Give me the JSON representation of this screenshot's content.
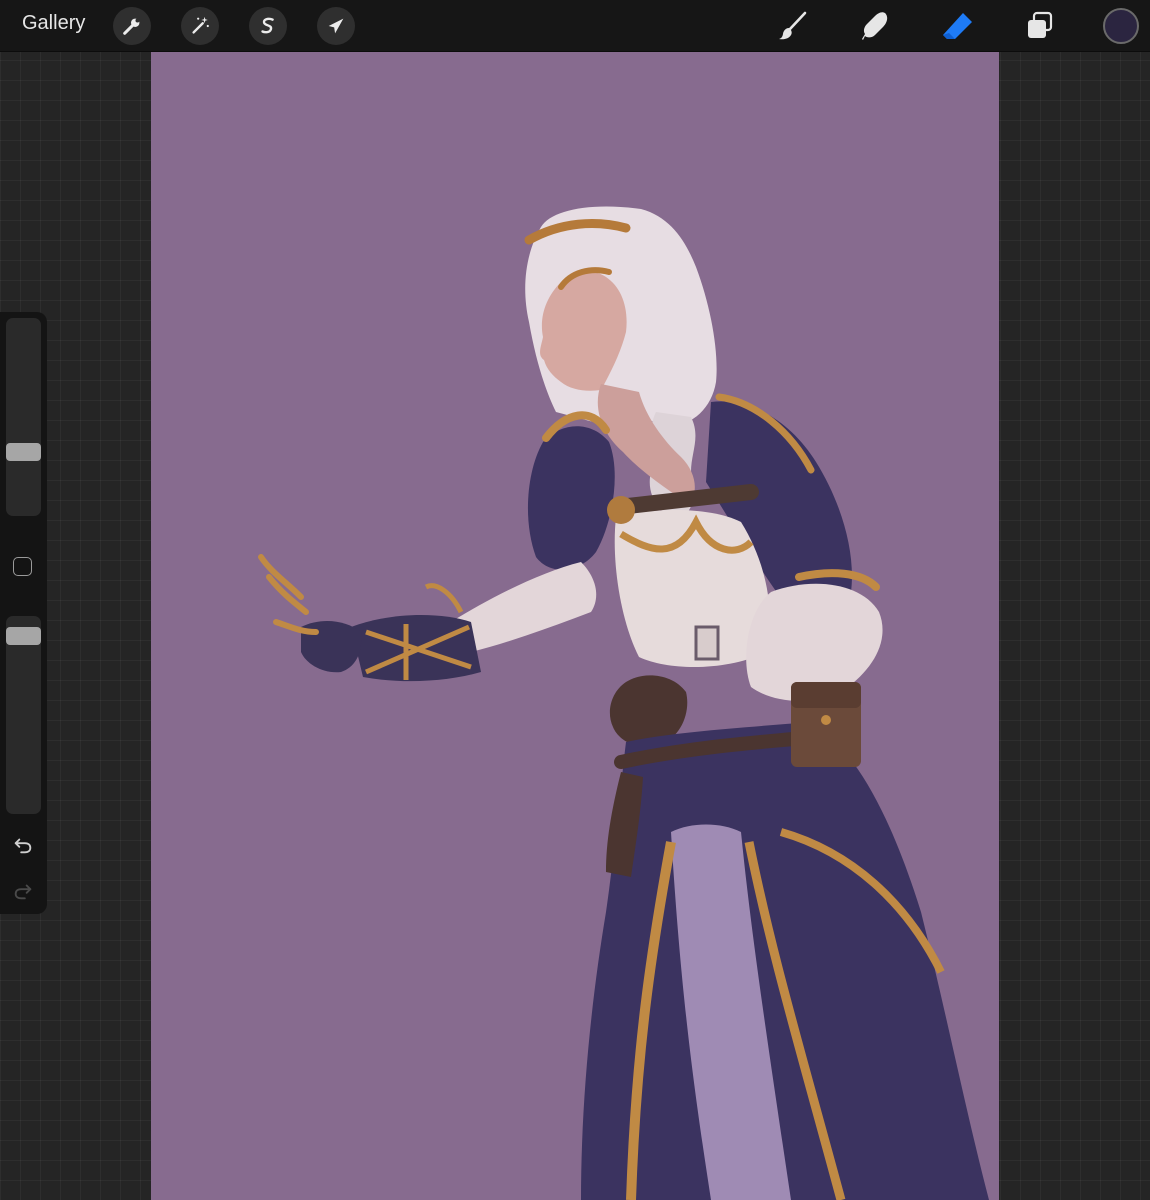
{
  "toolbar": {
    "gallery_label": "Gallery",
    "left_tools": [
      {
        "name": "actions",
        "icon": "wrench-icon"
      },
      {
        "name": "adjustments",
        "icon": "magic-wand-icon"
      },
      {
        "name": "selection",
        "icon": "selection-s-icon"
      },
      {
        "name": "transform",
        "icon": "arrow-cursor-icon"
      }
    ],
    "right_tools": [
      {
        "name": "brush",
        "icon": "brush-icon",
        "active": false
      },
      {
        "name": "smudge",
        "icon": "smudge-finger-icon",
        "active": false
      },
      {
        "name": "eraser",
        "icon": "eraser-icon",
        "active": true
      },
      {
        "name": "layers",
        "icon": "layers-icon",
        "active": false
      }
    ],
    "current_color": "#2b2540",
    "active_color": "#1e7bf6"
  },
  "canvas": {
    "background_color": "#876b8f"
  },
  "sidebar": {
    "brush_size_level": 0.3,
    "opacity_level": 0.95,
    "modify_icon": "square-icon",
    "undo_icon": "undo-icon",
    "redo_icon": "redo-icon"
  }
}
